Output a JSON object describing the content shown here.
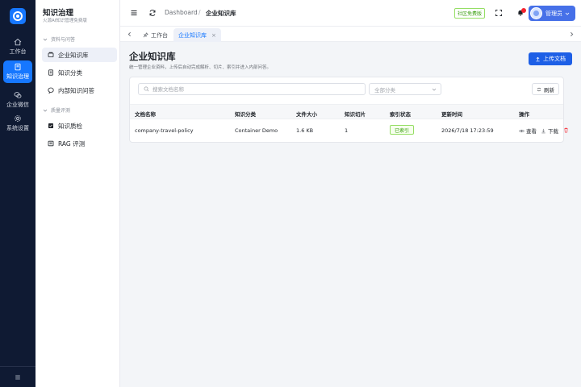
{
  "rail": {
    "items": [
      {
        "label": "工作台",
        "icon": "home-icon"
      },
      {
        "label": "知识治理",
        "icon": "book-icon"
      },
      {
        "label": "企业微信",
        "icon": "chat-icon"
      },
      {
        "label": "系统设置",
        "icon": "gear-icon"
      }
    ],
    "active": "知识治理"
  },
  "sidebar": {
    "title": "知识治理",
    "subtitle": "火源AI知识管理免费版",
    "sections": [
      {
        "label": "资料与问答",
        "items": [
          "企业知识库",
          "知识分类",
          "内部知识问答"
        ]
      },
      {
        "label": "质量评测",
        "items": [
          "知识质检",
          "RAG 评测"
        ]
      }
    ],
    "active": "企业知识库"
  },
  "header": {
    "breadcrumb": [
      "Dashboard",
      "企业知识库"
    ],
    "separator": "/",
    "edition_badge": "社区免费版",
    "user_name": "管理员"
  },
  "tabs": [
    {
      "label": "工作台",
      "icon": "pin-icon"
    },
    {
      "label": "企业知识库",
      "close": "×",
      "active": true
    }
  ],
  "page": {
    "title": "企业知识库",
    "description": "统一管理企业资料，上传后自动完成解析、切片、索引并进入内部问答。",
    "upload_label": "上传文档",
    "search_placeholder": "搜索文档名称",
    "category_placeholder": "全部分类",
    "refresh_label": "刷新"
  },
  "table": {
    "columns": [
      "文档名称",
      "知识分类",
      "文件大小",
      "知识切片",
      "索引状态",
      "更新时间",
      "操作"
    ],
    "rows": [
      {
        "name": "company-travel-policy",
        "category": "Container Demo",
        "size": "1.6 KB",
        "chunks": "1",
        "status": "已索引",
        "updated": "2026/7/18 17:23:59",
        "actions": [
          "查看",
          "下载"
        ]
      }
    ]
  },
  "colors": {
    "rail_bg": "#0f1a33",
    "accent": "#1677ff",
    "success": "#389e0d",
    "danger": "#f5222d"
  }
}
